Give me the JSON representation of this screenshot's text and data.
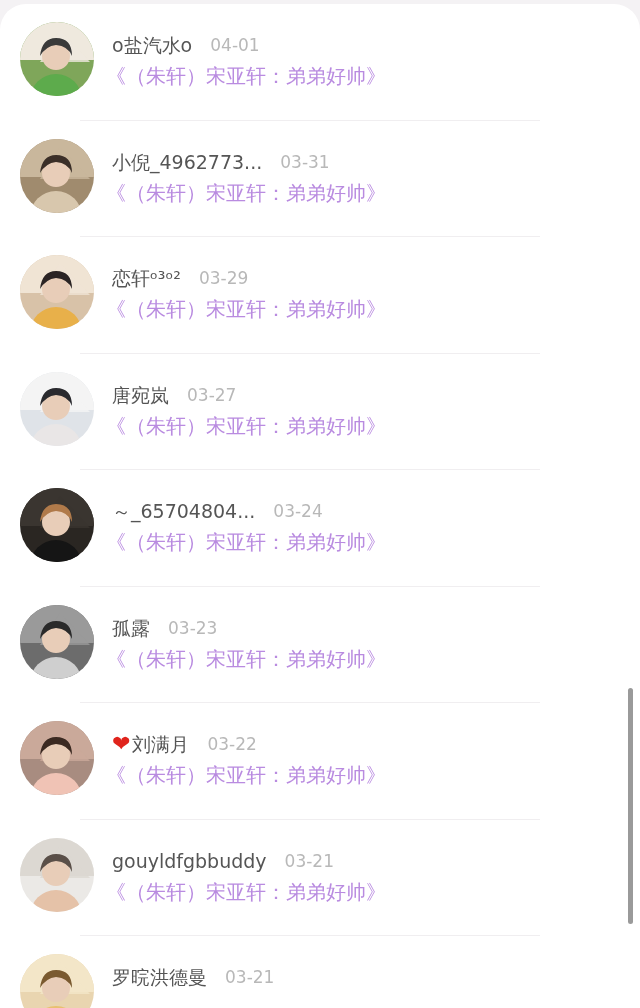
{
  "items": [
    {
      "name": "o盐汽水o",
      "date": "04-01",
      "title": "《（朱轩）宋亚轩：弟弟好帅》"
    },
    {
      "name": "小倪_4962773...",
      "date": "03-31",
      "title": "《（朱轩）宋亚轩：弟弟好帅》"
    },
    {
      "name": "恋轩ᵒ³ᵒ²",
      "date": "03-29",
      "title": "《（朱轩）宋亚轩：弟弟好帅》"
    },
    {
      "name": "唐宛岚",
      "date": "03-27",
      "title": "《（朱轩）宋亚轩：弟弟好帅》"
    },
    {
      "name": "～_65704804...",
      "date": "03-24",
      "title": "《（朱轩）宋亚轩：弟弟好帅》"
    },
    {
      "name": "孤露",
      "date": "03-23",
      "title": "《（朱轩）宋亚轩：弟弟好帅》"
    },
    {
      "prefix": "❤",
      "name": "刘满月",
      "date": "03-22",
      "title": "《（朱轩）宋亚轩：弟弟好帅》"
    },
    {
      "name": "gouyldfgbbuddy",
      "date": "03-21",
      "title": "《（朱轩）宋亚轩：弟弟好帅》"
    },
    {
      "name": "罗晥洪德曼",
      "date": "03-21"
    }
  ]
}
